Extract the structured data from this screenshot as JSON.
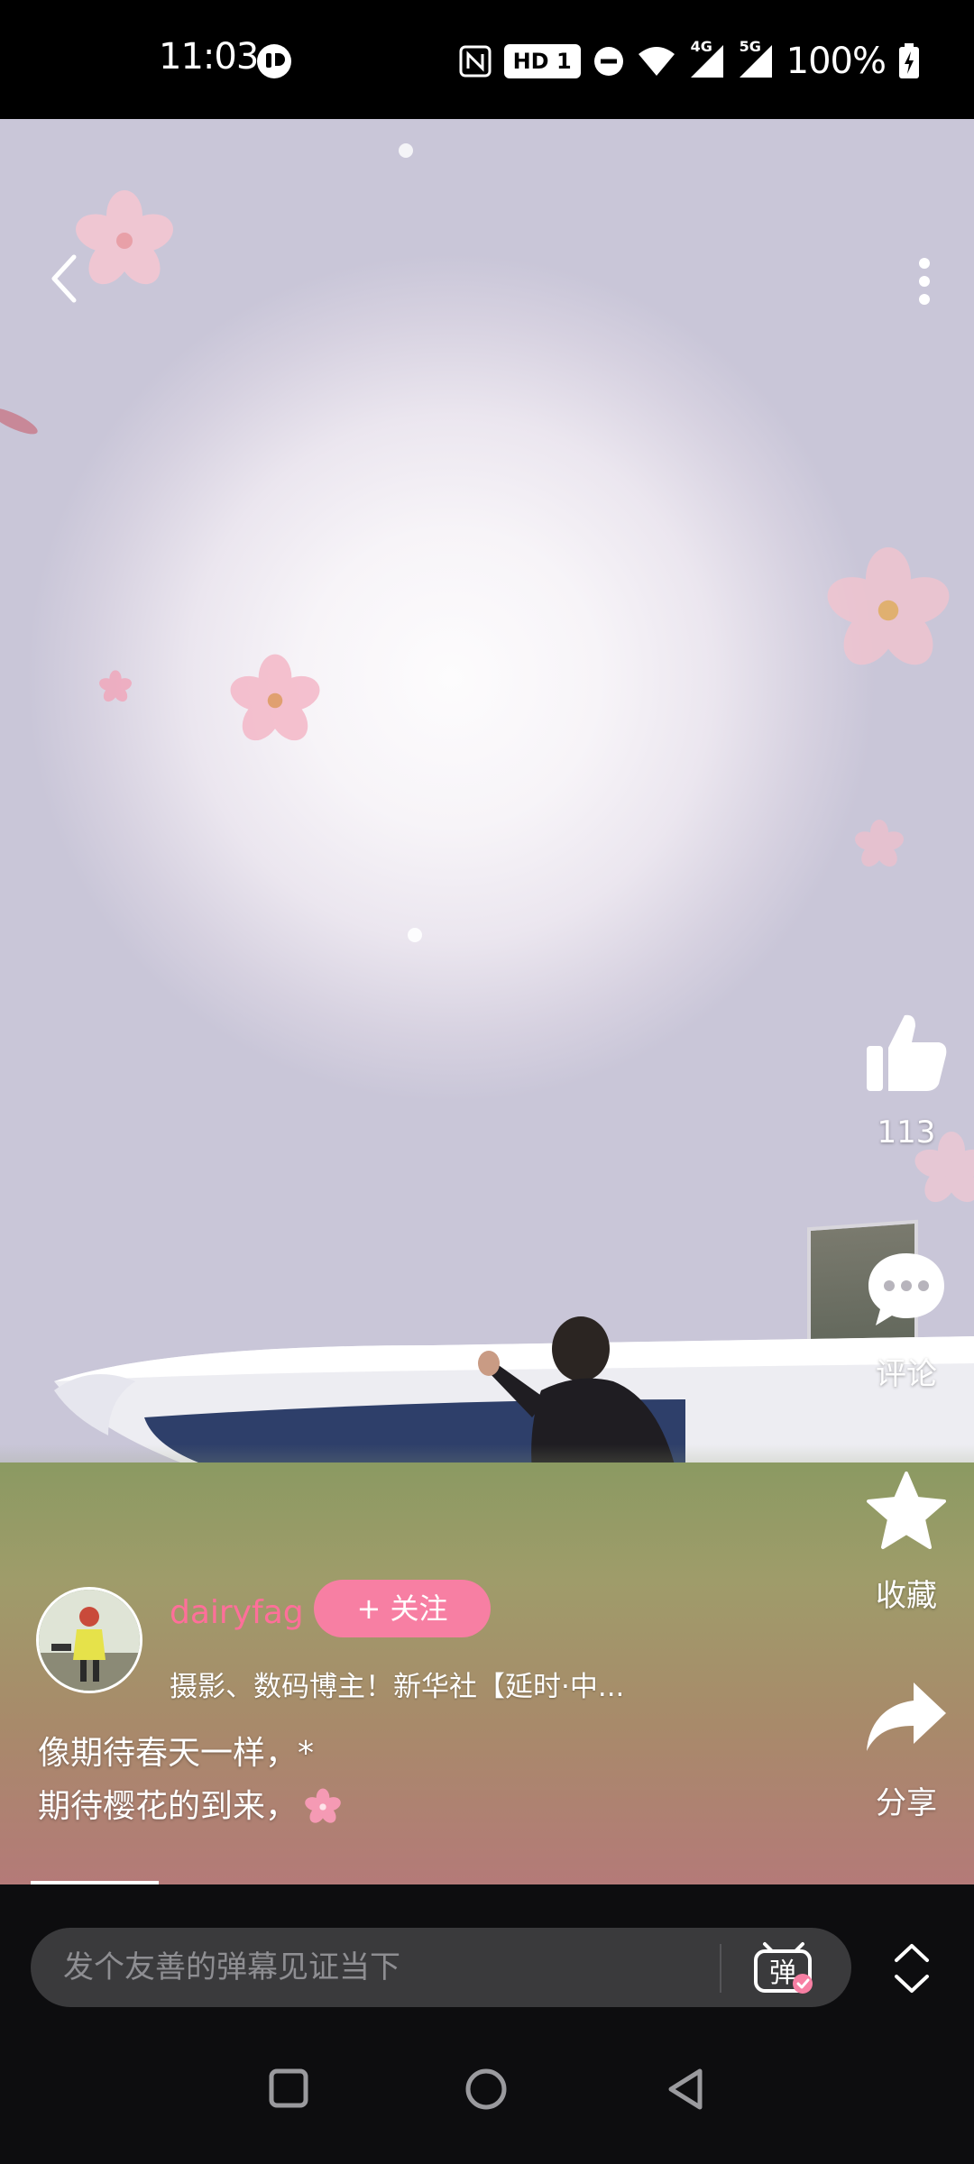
{
  "status_bar": {
    "time": "11:03",
    "hd_badge": "HD 1",
    "network_4g": "4G",
    "network_5g": "5G",
    "battery": "100%"
  },
  "video": {
    "progress": 0.14,
    "actions": {
      "like_count": "113",
      "comment_label": "评论",
      "favorite_label": "收藏",
      "share_label": "分享"
    },
    "author": {
      "name": "dairyfag",
      "follow_label": "+ 关注",
      "description": "摄影、数码博主！新华社【延时·中..."
    },
    "caption": {
      "line1": "像期待春天一样，*",
      "line2": "期待樱花的到来，"
    }
  },
  "bottom_bar": {
    "danmaku_placeholder": "发个友善的弹幕见证当下"
  },
  "icons": {
    "back": "chevron-left-icon",
    "more": "more-vertical-icon",
    "like": "thumbs-up-icon",
    "comment": "comment-bubble-icon",
    "favorite": "star-icon",
    "share": "share-arrow-icon",
    "danmaku": "danmaku-toggle-icon",
    "expand": "expand-collapse-icon"
  },
  "colors": {
    "accent_pink": "#f77fa3",
    "author_pink": "#ff6f9a",
    "bar_bg": "#0d0d0f",
    "input_bg": "#3a3a3c"
  }
}
